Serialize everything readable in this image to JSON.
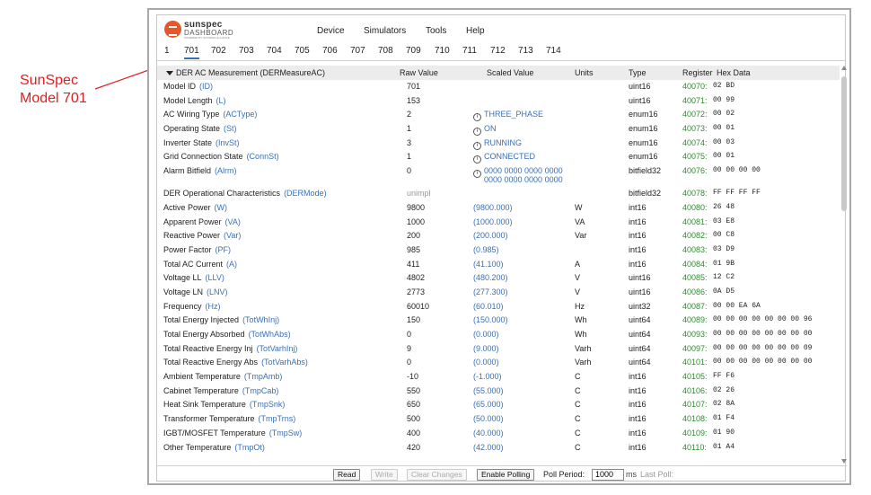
{
  "annotation": {
    "line1": "SunSpec",
    "line2": "Model 701"
  },
  "logo": {
    "word": "sunspec",
    "sub": "DASHBOARD",
    "tiny": "POWERED BY SUNSPEC ALLIANCE"
  },
  "menu": {
    "device": "Device",
    "simulators": "Simulators",
    "tools": "Tools",
    "help": "Help"
  },
  "tabs": [
    "1",
    "701",
    "702",
    "703",
    "704",
    "705",
    "706",
    "707",
    "708",
    "709",
    "710",
    "711",
    "712",
    "713",
    "714"
  ],
  "active_tab": "701",
  "table": {
    "group_label": "DER AC Measurement (DERMeasureAC)",
    "headers": {
      "raw": "Raw Value",
      "scaled": "Scaled Value",
      "units": "Units",
      "type": "Type",
      "register": "Register",
      "hex": "Hex Data"
    },
    "rows": [
      {
        "name": "Model ID",
        "pt": "(ID)",
        "raw": "701",
        "scaled": "",
        "info": false,
        "units": "",
        "type": "uint16",
        "reg": "40070:",
        "hex": "02 BD"
      },
      {
        "name": "Model Length",
        "pt": "(L)",
        "raw": "153",
        "scaled": "",
        "info": false,
        "units": "",
        "type": "uint16",
        "reg": "40071:",
        "hex": "00 99"
      },
      {
        "name": "AC Wiring Type",
        "pt": "(ACType)",
        "raw": "2",
        "scaled": "THREE_PHASE",
        "info": true,
        "units": "",
        "type": "enum16",
        "reg": "40072:",
        "hex": "00 02"
      },
      {
        "name": "Operating State",
        "pt": "(St)",
        "raw": "1",
        "scaled": "ON",
        "info": true,
        "units": "",
        "type": "enum16",
        "reg": "40073:",
        "hex": "00 01"
      },
      {
        "name": "Inverter State",
        "pt": "(InvSt)",
        "raw": "3",
        "scaled": "RUNNING",
        "info": true,
        "units": "",
        "type": "enum16",
        "reg": "40074:",
        "hex": "00 03"
      },
      {
        "name": "Grid Connection State",
        "pt": "(ConnSt)",
        "raw": "1",
        "scaled": "CONNECTED",
        "info": true,
        "units": "",
        "type": "enum16",
        "reg": "40075:",
        "hex": "00 01"
      },
      {
        "name": "Alarm Bitfield",
        "pt": "(Alrm)",
        "raw": "0",
        "scaled": "0000 0000 0000 0000\n0000 0000 0000 0000",
        "info": true,
        "multi": true,
        "units": "",
        "type": "bitfield32",
        "reg": "40076:",
        "hex": "00 00 00 00"
      },
      {
        "name": "DER Operational Characteristics",
        "pt": "(DERMode)",
        "raw": "unimpl",
        "unimpl": true,
        "scaled": "",
        "info": false,
        "units": "",
        "type": "bitfield32",
        "reg": "40078:",
        "hex": "FF FF FF FF"
      },
      {
        "name": "Active Power",
        "pt": "(W)",
        "raw": "9800",
        "scaled": "(9800.000)",
        "info": false,
        "units": "W",
        "type": "int16",
        "reg": "40080:",
        "hex": "26 48"
      },
      {
        "name": "Apparent Power",
        "pt": "(VA)",
        "raw": "1000",
        "scaled": "(1000.000)",
        "info": false,
        "units": "VA",
        "type": "int16",
        "reg": "40081:",
        "hex": "03 E8"
      },
      {
        "name": "Reactive Power",
        "pt": "(Var)",
        "raw": "200",
        "scaled": "(200.000)",
        "info": false,
        "units": "Var",
        "type": "int16",
        "reg": "40082:",
        "hex": "00 C8"
      },
      {
        "name": "Power Factor",
        "pt": "(PF)",
        "raw": "985",
        "scaled": "(0.985)",
        "info": false,
        "units": "",
        "type": "int16",
        "reg": "40083:",
        "hex": "03 D9"
      },
      {
        "name": "Total AC Current",
        "pt": "(A)",
        "raw": "411",
        "scaled": "(41.100)",
        "info": false,
        "units": "A",
        "type": "int16",
        "reg": "40084:",
        "hex": "01 9B"
      },
      {
        "name": "Voltage LL",
        "pt": "(LLV)",
        "raw": "4802",
        "scaled": "(480.200)",
        "info": false,
        "units": "V",
        "type": "uint16",
        "reg": "40085:",
        "hex": "12 C2"
      },
      {
        "name": "Voltage LN",
        "pt": "(LNV)",
        "raw": "2773",
        "scaled": "(277.300)",
        "info": false,
        "units": "V",
        "type": "uint16",
        "reg": "40086:",
        "hex": "0A D5"
      },
      {
        "name": "Frequency",
        "pt": "(Hz)",
        "raw": "60010",
        "scaled": "(60.010)",
        "info": false,
        "units": "Hz",
        "type": "uint32",
        "reg": "40087:",
        "hex": "00 00 EA 6A"
      },
      {
        "name": "Total Energy Injected",
        "pt": "(TotWhInj)",
        "raw": "150",
        "scaled": "(150.000)",
        "info": false,
        "units": "Wh",
        "type": "uint64",
        "reg": "40089:",
        "hex": "00 00 00 00 00 00 00 96"
      },
      {
        "name": "Total Energy Absorbed",
        "pt": "(TotWhAbs)",
        "raw": "0",
        "scaled": "(0.000)",
        "info": false,
        "units": "Wh",
        "type": "uint64",
        "reg": "40093:",
        "hex": "00 00 00 00 00 00 00 00"
      },
      {
        "name": "Total Reactive Energy Inj",
        "pt": "(TotVarhInj)",
        "raw": "9",
        "scaled": "(9.000)",
        "info": false,
        "units": "Varh",
        "type": "uint64",
        "reg": "40097:",
        "hex": "00 00 00 00 00 00 00 09"
      },
      {
        "name": "Total Reactive Energy Abs",
        "pt": "(TotVarhAbs)",
        "raw": "0",
        "scaled": "(0.000)",
        "info": false,
        "units": "Varh",
        "type": "uint64",
        "reg": "40101:",
        "hex": "00 00 00 00 00 00 00 00"
      },
      {
        "name": "Ambient Temperature",
        "pt": "(TmpAmb)",
        "raw": "-10",
        "scaled": "(-1.000)",
        "info": false,
        "units": "C",
        "type": "int16",
        "reg": "40105:",
        "hex": "FF F6"
      },
      {
        "name": "Cabinet Temperature",
        "pt": "(TmpCab)",
        "raw": "550",
        "scaled": "(55.000)",
        "info": false,
        "units": "C",
        "type": "int16",
        "reg": "40106:",
        "hex": "02 26"
      },
      {
        "name": "Heat Sink Temperature",
        "pt": "(TmpSnk)",
        "raw": "650",
        "scaled": "(65.000)",
        "info": false,
        "units": "C",
        "type": "int16",
        "reg": "40107:",
        "hex": "02 8A"
      },
      {
        "name": "Transformer Temperature",
        "pt": "(TmpTrns)",
        "raw": "500",
        "scaled": "(50.000)",
        "info": false,
        "units": "C",
        "type": "int16",
        "reg": "40108:",
        "hex": "01 F4"
      },
      {
        "name": "IGBT/MOSFET Temperature",
        "pt": "(TmpSw)",
        "raw": "400",
        "scaled": "(40.000)",
        "info": false,
        "units": "C",
        "type": "int16",
        "reg": "40109:",
        "hex": "01 90"
      },
      {
        "name": "Other Temperature",
        "pt": "(TmpOt)",
        "raw": "420",
        "scaled": "(42.000)",
        "info": false,
        "units": "C",
        "type": "int16",
        "reg": "40110:",
        "hex": "01 A4"
      }
    ]
  },
  "bottom": {
    "read": "Read",
    "write": "Write",
    "clear": "Clear Changes",
    "enable_polling": "Enable Polling",
    "poll_period_label": "Poll Period:",
    "poll_period_value": "1000",
    "ms": "ms",
    "last_poll": "Last Poll:"
  },
  "colors": {
    "annotation": "#e02020",
    "point_id": "#3a6fb5",
    "register": "#2e8b2e",
    "logo": "#e8552a"
  }
}
